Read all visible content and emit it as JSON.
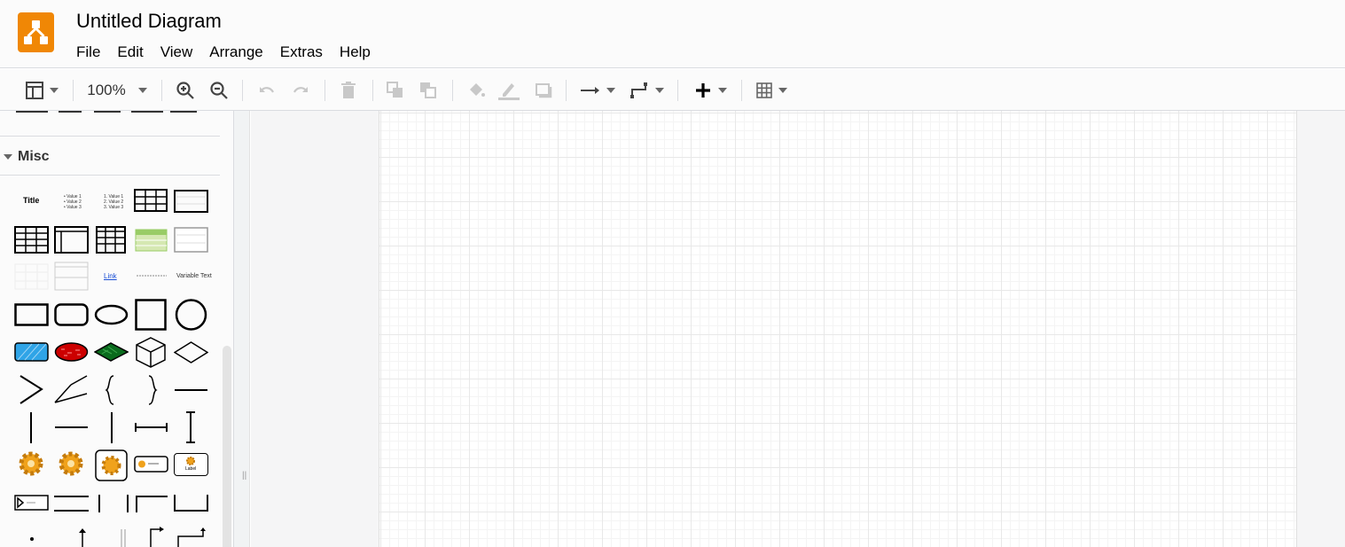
{
  "app": {
    "title": "Untitled Diagram",
    "logo_color": "#f08705"
  },
  "menu": [
    "File",
    "Edit",
    "View",
    "Arrange",
    "Extras",
    "Help"
  ],
  "toolbar": {
    "zoom": "100%",
    "icons": [
      "panel-layout-icon",
      "zoom-in-icon",
      "zoom-out-icon",
      "undo-icon",
      "redo-icon",
      "delete-icon",
      "to-front-icon",
      "to-back-icon",
      "fill-color-icon",
      "line-color-icon",
      "shadow-icon",
      "connection-icon",
      "waypoints-icon",
      "insert-icon",
      "table-icon"
    ]
  },
  "sidebar": {
    "section_title": "Misc",
    "labels": {
      "title": "Title",
      "list1": [
        "Value 1",
        "Value 2",
        "Value 3"
      ],
      "list2": [
        "1. Value 1",
        "2. Value 2",
        "3. Value 3"
      ],
      "link": "Link",
      "variable_text": "Variable Text",
      "label": "Label"
    }
  }
}
